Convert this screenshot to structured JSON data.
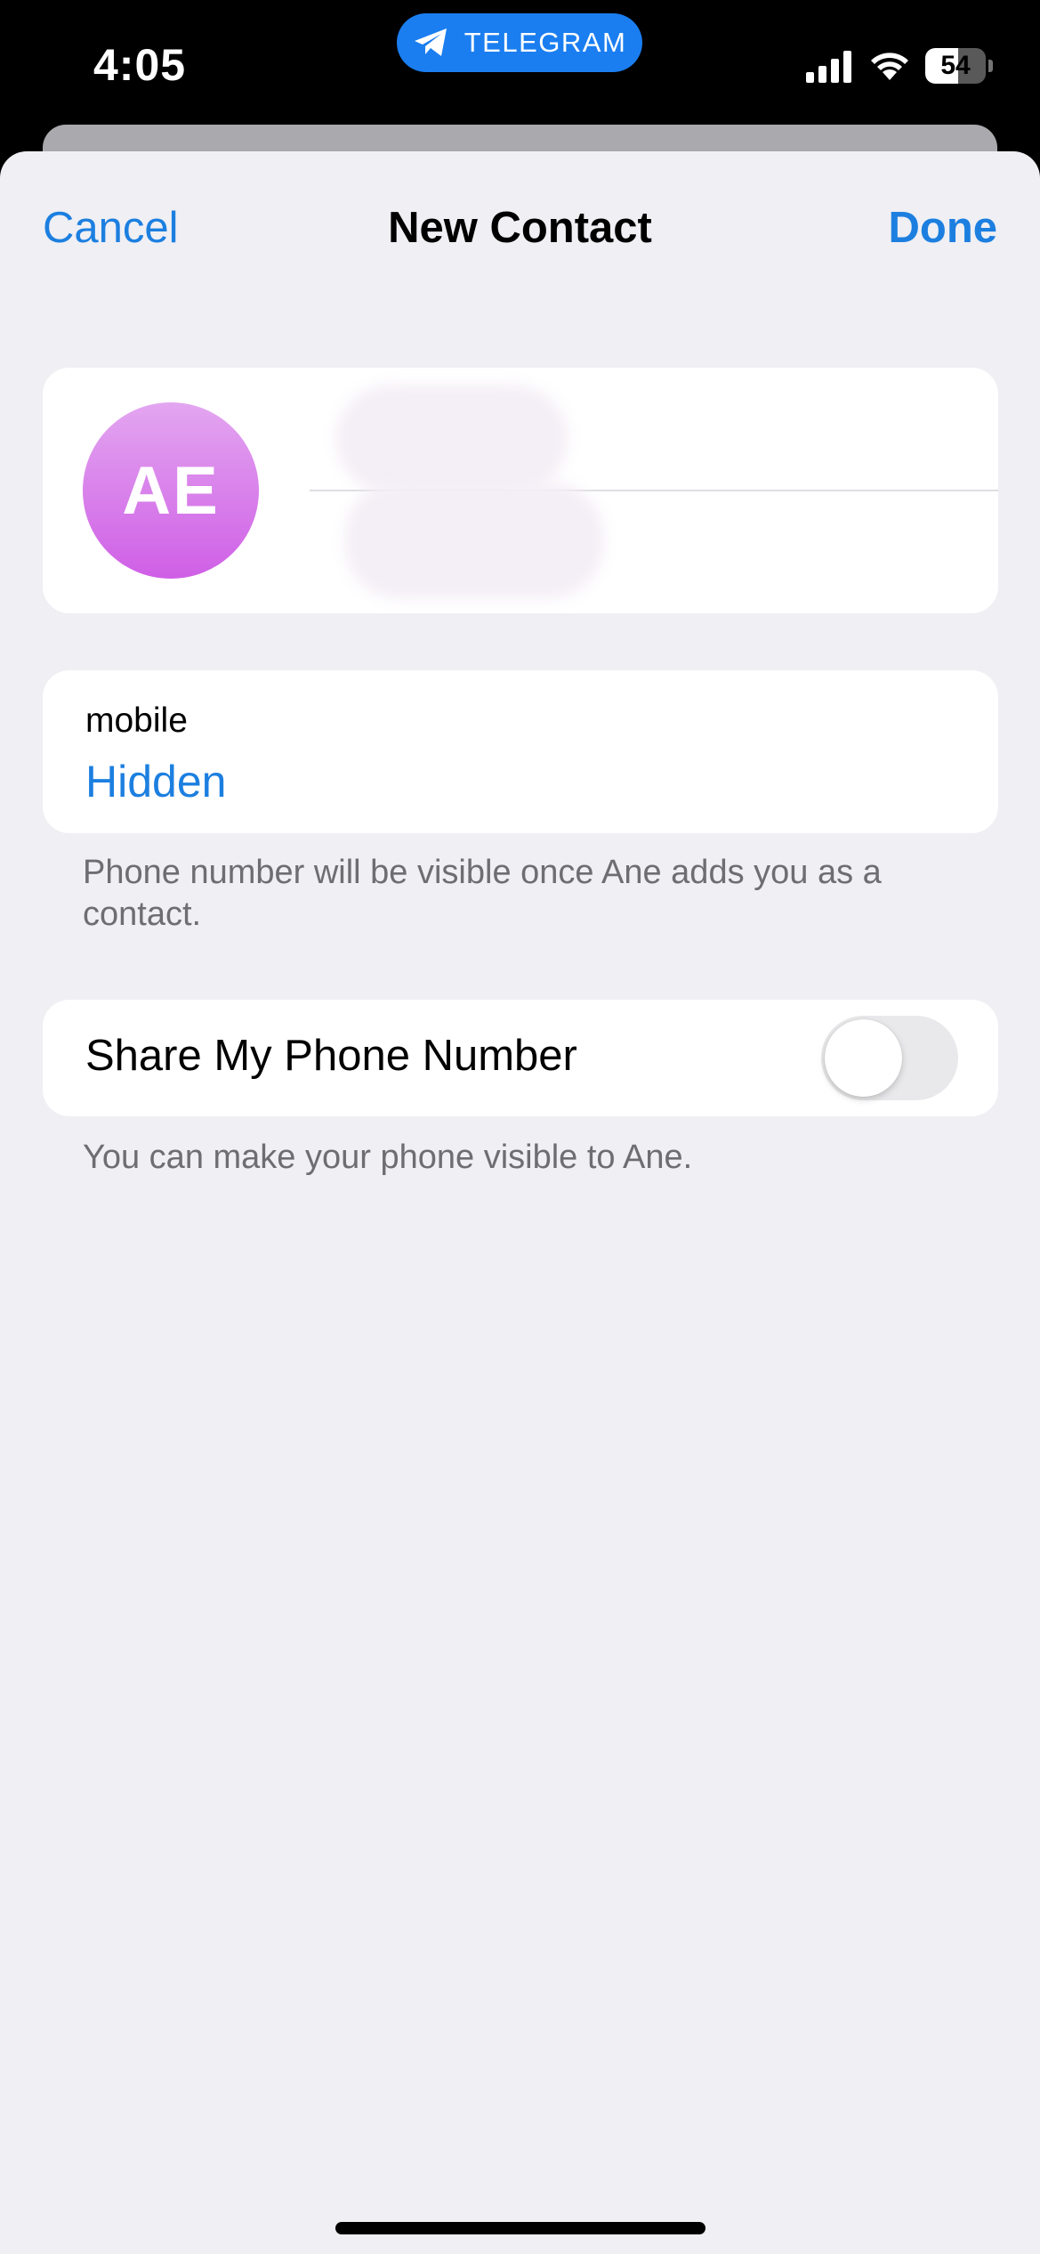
{
  "status_bar": {
    "time": "4:05",
    "app_pill_label": "TELEGRAM",
    "battery_percent": "54",
    "battery_level": 0.54
  },
  "nav": {
    "cancel_label": "Cancel",
    "title": "New Contact",
    "done_label": "Done"
  },
  "contact": {
    "avatar_initials": "AE",
    "avatar_color_top": "#e3a6f0",
    "avatar_color_bottom": "#cf5fe6"
  },
  "phone": {
    "label": "mobile",
    "value": "Hidden",
    "footnote": "Phone number will be visible once Ane adds you as a contact."
  },
  "share": {
    "label": "Share My Phone Number",
    "enabled": false,
    "footnote": "You can make your phone visible to Ane."
  },
  "colors": {
    "accent": "#1c7fe0",
    "background": "#efeff4",
    "telegram_blue": "#1a7ef0"
  }
}
